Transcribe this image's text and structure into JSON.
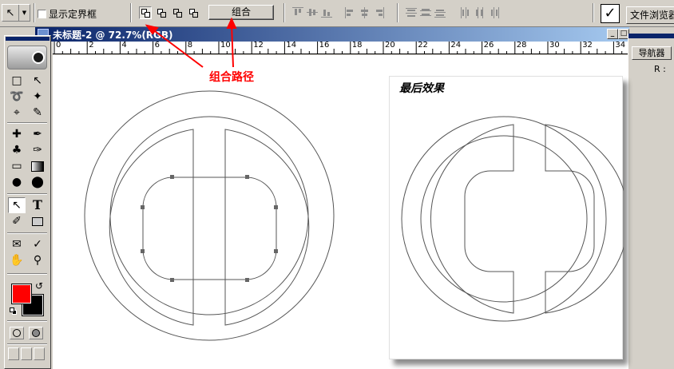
{
  "options_bar": {
    "show_bounding_box_label": "显示定界框",
    "combine_button_label": "组合",
    "file_browser_tab": "文件浏览器",
    "commit_icon": "checkmark-icon"
  },
  "document": {
    "title": "未标题-2 @ 72.7%(RGB)",
    "ruler_labels": [
      "0",
      "2",
      "4",
      "6",
      "8",
      "10",
      "12",
      "14",
      "16",
      "18",
      "20",
      "22",
      "24",
      "26",
      "28",
      "30",
      "32",
      "34"
    ]
  },
  "toolbox": {
    "foreground_color": "#ff0000",
    "background_color": "#000000",
    "tools": [
      "marquee-icon",
      "move-icon",
      "lasso-icon",
      "magic-wand-icon",
      "crop-icon",
      "slice-icon",
      "healing-brush-icon",
      "brush-icon",
      "clone-stamp-icon",
      "history-brush-icon",
      "eraser-icon",
      "gradient-icon",
      "blur-icon",
      "dodge-icon",
      "path-selection-icon",
      "type-icon",
      "pen-icon",
      "rectangle-shape-icon",
      "notes-icon",
      "eyedropper-icon",
      "hand-icon",
      "zoom-icon"
    ]
  },
  "navigator": {
    "tab_label": "导航器",
    "readout_label": "R :"
  },
  "annotation": {
    "label": "组合路径",
    "color": "#ff0000"
  },
  "result_panel": {
    "title": "最后效果"
  }
}
